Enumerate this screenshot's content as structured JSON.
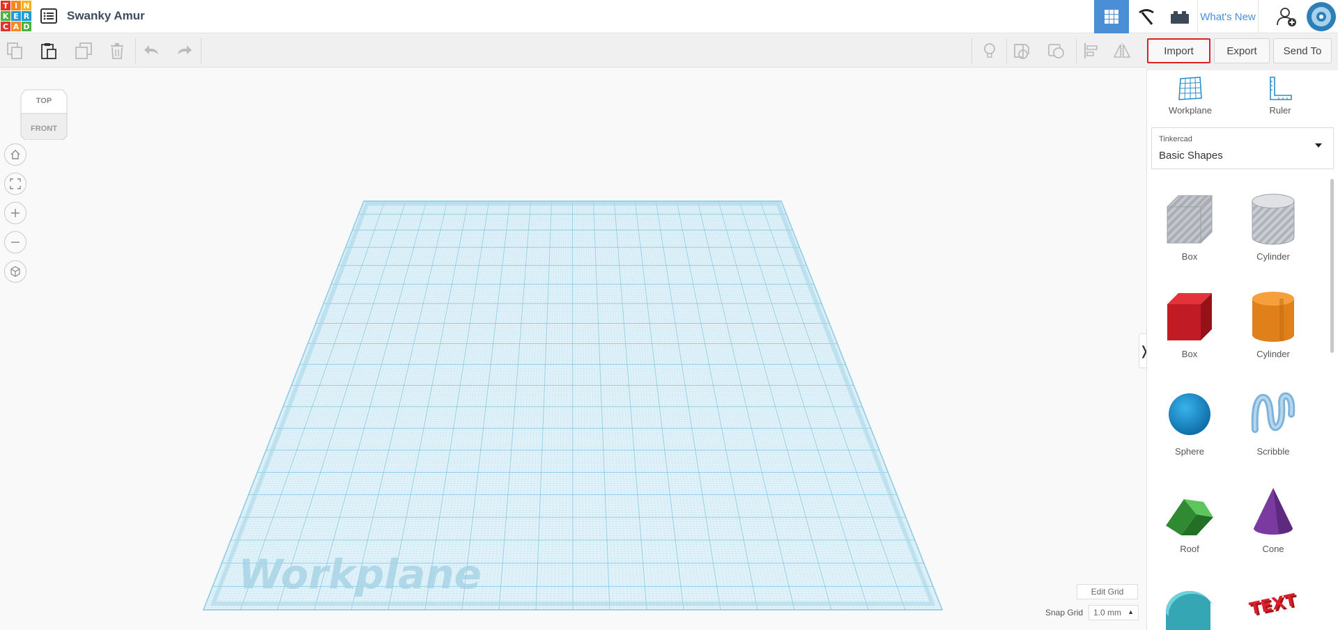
{
  "header": {
    "logo_letters": [
      "T",
      "I",
      "N",
      "K",
      "E",
      "R",
      "C",
      "A",
      "D"
    ],
    "logo_colors": [
      "#e3322a",
      "#f5891f",
      "#f5b318",
      "#4ab33f",
      "#1f9ad6",
      "#1f9ad6",
      "#e3322a",
      "#f5891f",
      "#4ab33f"
    ],
    "design_title": "Swanky Amur",
    "whats_new": "What's New",
    "accent_color": "#4a8fd6"
  },
  "toolbar": {
    "icons": [
      "copy-icon",
      "paste-icon",
      "duplicate-icon",
      "delete-icon",
      "undo-icon",
      "redo-icon",
      "light-bulb-icon",
      "hole-icon",
      "group-icon",
      "align-icon",
      "mirror-icon"
    ],
    "import_label": "Import",
    "export_label": "Export",
    "send_to_label": "Send To"
  },
  "viewcube": {
    "top": "TOP",
    "front": "FRONT"
  },
  "canvas": {
    "workplane_label": "Workplane",
    "edit_grid": "Edit Grid",
    "snap_grid_label": "Snap Grid",
    "snap_grid_value": "1.0 mm"
  },
  "panel": {
    "workplane_tool": "Workplane",
    "ruler_tool": "Ruler",
    "library_source": "Tinkercad",
    "library_name": "Basic Shapes",
    "shapes": [
      {
        "label": "Box",
        "color": "#bfc3ca"
      },
      {
        "label": "Cylinder",
        "color": "#c8cbd0"
      },
      {
        "label": "Box",
        "color": "#d8202a"
      },
      {
        "label": "Cylinder",
        "color": "#e8841a"
      },
      {
        "label": "Sphere",
        "color": "#1d95d4"
      },
      {
        "label": "Scribble",
        "color": "#8fbfe0"
      },
      {
        "label": "Roof",
        "color": "#3aa53c"
      },
      {
        "label": "Cone",
        "color": "#7b3aa0"
      },
      {
        "label": "",
        "color": "#3db2bf"
      },
      {
        "label": "",
        "color": "#d21f26"
      }
    ]
  }
}
